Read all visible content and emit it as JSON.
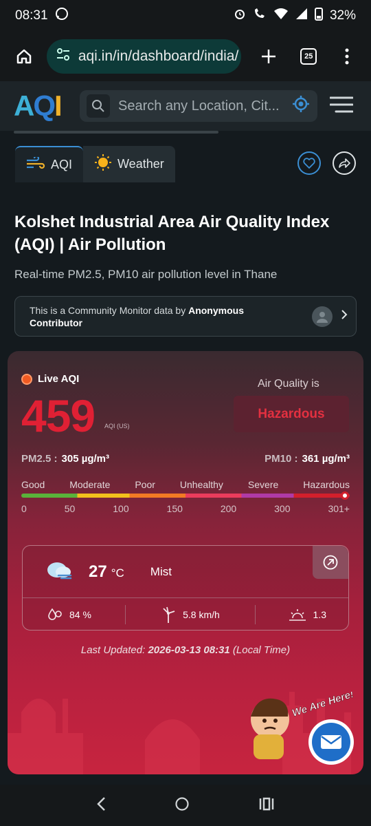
{
  "status_bar": {
    "time": "08:31",
    "battery": "32%"
  },
  "browser": {
    "url": "aqi.in/in/dashboard/india/",
    "tab_count": "25"
  },
  "site": {
    "logo": "AQI",
    "search_placeholder": "Search any Location, Cit..."
  },
  "tabs": [
    {
      "label": "AQI"
    },
    {
      "label": "Weather"
    }
  ],
  "page": {
    "title": "Kolshet Industrial Area Air Quality Index (AQI) | Air Pollution",
    "subtitle": "Real-time PM2.5, PM10 air pollution level in Thane",
    "community_prefix": "This is a Community Monitor data by ",
    "community_author": "Anonymous Contributor"
  },
  "aqi_card": {
    "live_label": "Live AQI",
    "aqi_value": "459",
    "aqi_unit": "AQI (US)",
    "air_quality_label": "Air Quality is",
    "status": "Hazardous",
    "pm25_label": "PM2.5 :",
    "pm25_value": "305 µg/m³",
    "pm10_label": "PM10 :",
    "pm10_value": "361 µg/m³",
    "scale_labels": [
      "Good",
      "Moderate",
      "Poor",
      "Unhealthy",
      "Severe",
      "Hazardous"
    ],
    "scale_numbers": [
      "0",
      "50",
      "100",
      "150",
      "200",
      "300",
      "301+"
    ],
    "scale_colors": [
      "#59b23a",
      "#f2c01c",
      "#f27a24",
      "#ea3c5c",
      "#b03aa6",
      "#d31f2c"
    ],
    "weather": {
      "temperature": "27",
      "temp_unit": "°C",
      "condition": "Mist",
      "humidity": "84 %",
      "wind": "5.8 km/h",
      "uv": "1.3"
    },
    "updated_prefix": "Last Updated: ",
    "updated_time": "2026-03-13 08:31",
    "updated_suffix": " (Local Time)"
  },
  "mascot": {
    "text": "We Are Here!"
  },
  "colors": {
    "accent": "#3b8fd4",
    "hazard": "#e02034",
    "card_bg": "#b9213f"
  }
}
